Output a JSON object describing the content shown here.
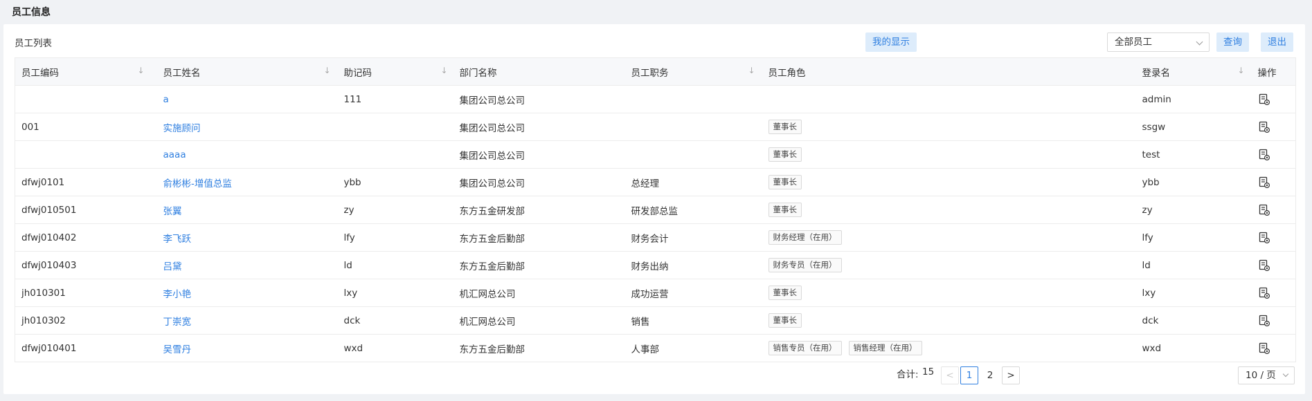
{
  "page": {
    "title": "员工信息"
  },
  "panel": {
    "title": "员工列表"
  },
  "toolbar": {
    "my_display": "我的显示",
    "filter_value": "全部员工",
    "query": "查询",
    "exit": "退出"
  },
  "table": {
    "columns": [
      "员工编码",
      "员工姓名",
      "助记码",
      "部门名称",
      "员工职务",
      "员工角色",
      "登录名",
      "操作"
    ],
    "rows": [
      {
        "code": "",
        "name": "a",
        "mnemonic": "111",
        "dept": "集团公司总公司",
        "position": "",
        "roles": [],
        "login": "admin"
      },
      {
        "code": "001",
        "name": "实施顾问",
        "mnemonic": "",
        "dept": "集团公司总公司",
        "position": "",
        "roles": [
          "董事长"
        ],
        "login": "ssgw"
      },
      {
        "code": "",
        "name": "aaaa",
        "mnemonic": "",
        "dept": "集团公司总公司",
        "position": "",
        "roles": [
          "董事长"
        ],
        "login": "test"
      },
      {
        "code": "dfwj0101",
        "name": "俞彬彬-增值总监",
        "mnemonic": "ybb",
        "dept": "集团公司总公司",
        "position": "总经理",
        "roles": [
          "董事长"
        ],
        "login": "ybb"
      },
      {
        "code": "dfwj010501",
        "name": "张翼",
        "mnemonic": "zy",
        "dept": "东方五金研发部",
        "position": "研发部总监",
        "roles": [
          "董事长"
        ],
        "login": "zy"
      },
      {
        "code": "dfwj010402",
        "name": "李飞跃",
        "mnemonic": "lfy",
        "dept": "东方五金后勤部",
        "position": "财务会计",
        "roles": [
          "财务经理（在用）"
        ],
        "login": "lfy"
      },
      {
        "code": "dfwj010403",
        "name": "吕黛",
        "mnemonic": "ld",
        "dept": "东方五金后勤部",
        "position": "财务出纳",
        "roles": [
          "财务专员（在用）"
        ],
        "login": "ld"
      },
      {
        "code": "jh010301",
        "name": "李小艳",
        "mnemonic": "lxy",
        "dept": "机汇网总公司",
        "position": "成功运营",
        "roles": [
          "董事长"
        ],
        "login": "lxy"
      },
      {
        "code": "jh010302",
        "name": "丁崇宽",
        "mnemonic": "dck",
        "dept": "机汇网总公司",
        "position": "销售",
        "roles": [
          "董事长"
        ],
        "login": "dck"
      },
      {
        "code": "dfwj010401",
        "name": "吴雪丹",
        "mnemonic": "wxd",
        "dept": "东方五金后勤部",
        "position": "人事部",
        "roles": [
          "销售专员（在用）",
          "销售经理（在用）"
        ],
        "login": "wxd"
      }
    ]
  },
  "pagination": {
    "total_label": "合计:",
    "total": "15",
    "prev": "<",
    "pages": [
      "1",
      "2"
    ],
    "next": ">",
    "page_size": "10 / 页"
  }
}
